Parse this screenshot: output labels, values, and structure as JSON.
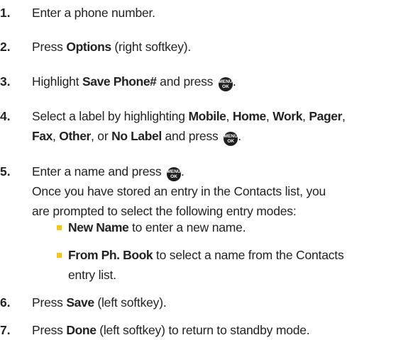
{
  "colors": {
    "bullet": "#f7c415",
    "text": "#222222",
    "button": "#1f1f1f"
  },
  "button_icon": {
    "name": "menu-ok-key-icon",
    "top": "MENU",
    "bottom": "OK"
  },
  "steps": [
    {
      "num": "1.",
      "t1": "Enter a phone number."
    },
    {
      "num": "2.",
      "t1": "Press ",
      "b1": "Options",
      "t2": " (right softkey)."
    },
    {
      "num": "3.",
      "t1": "Highlight ",
      "b1": "Save Phone#",
      "t2": " and press "
    },
    {
      "num": "4.",
      "t1": "Select a label by highlighting ",
      "b1": "Mobile",
      "s1": ", ",
      "b2": "Home",
      "s2": ", ",
      "b3": "Work",
      "s3": ", ",
      "b4": "Pager",
      "s4": ",",
      "b5": "Fax",
      "s5": ", ",
      "b6": "Other",
      "s6": ", or ",
      "b7": "No Label",
      "s7": " and press "
    },
    {
      "num": "5.",
      "t1": "Enter a name and press ",
      "p1": "Once you have stored an entry in the Contacts list, you",
      "p2": "are prompted to select the following entry modes:"
    },
    {
      "num": "6.",
      "t1": "Press ",
      "b1": "Save",
      "t2": " (left softkey)."
    },
    {
      "num": "7.",
      "t1": "Press ",
      "b1": "Done",
      "t2": " (left softkey) to return to standby mode."
    }
  ],
  "bullets": [
    {
      "b": "New Name",
      "t": " to enter a new name."
    },
    {
      "b": "From Ph. Book",
      "t": " to select a name from the Contacts",
      "t2": "entry list."
    }
  ]
}
